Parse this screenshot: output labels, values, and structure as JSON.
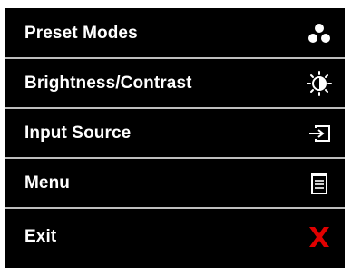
{
  "menu": {
    "items": [
      {
        "label": "Preset Modes",
        "icon": "preset-modes-icon"
      },
      {
        "label": "Brightness/Contrast",
        "icon": "brightness-icon"
      },
      {
        "label": "Input Source",
        "icon": "input-source-icon"
      },
      {
        "label": "Menu",
        "icon": "menu-icon"
      },
      {
        "label": "Exit",
        "icon": "exit-icon"
      }
    ]
  },
  "colors": {
    "background": "#000000",
    "text": "#ffffff",
    "divider": "#bdbdbd",
    "exit_icon": "#e00000"
  }
}
